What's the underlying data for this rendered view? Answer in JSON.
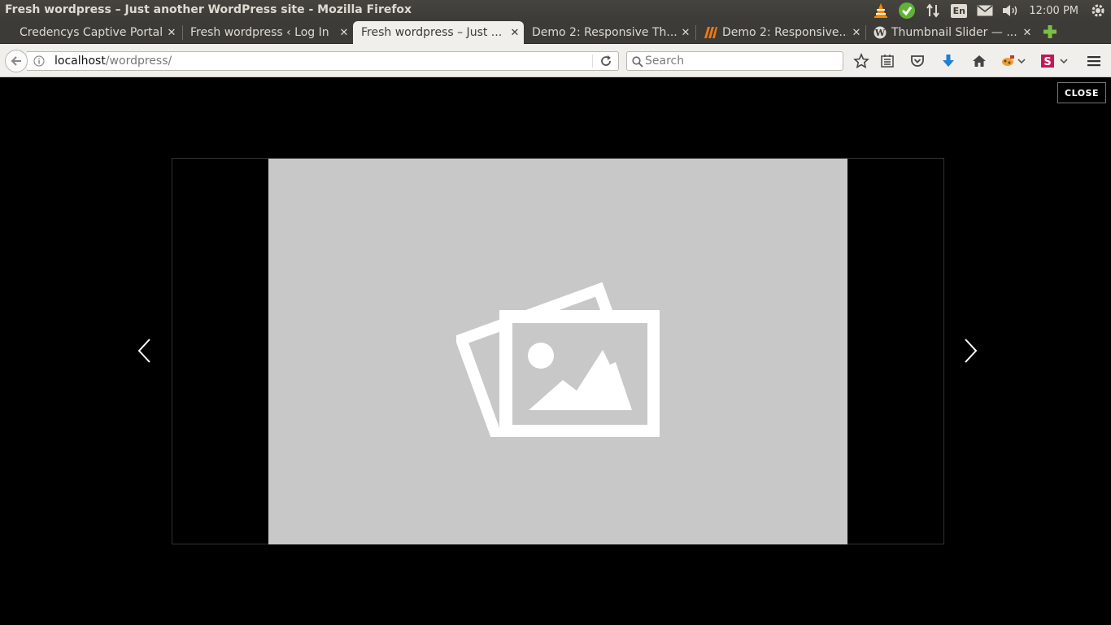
{
  "window": {
    "title": "Fresh wordpress – Just another WordPress site - Mozilla Firefox",
    "clock": "12:00 PM",
    "keyboard_layout": "En",
    "tray_icons": [
      "vlc-icon",
      "check-update-icon",
      "network-transfer-icon",
      "keyboard-layout-icon",
      "mail-icon",
      "volume-icon",
      "settings-gear-icon"
    ]
  },
  "tabs": [
    {
      "title": "Credencys Captive Portal",
      "favicon": "none",
      "active": false
    },
    {
      "title": "Fresh wordpress ‹ Log In",
      "favicon": "none",
      "active": false
    },
    {
      "title": "Fresh wordpress – Just ...",
      "favicon": "none",
      "active": true
    },
    {
      "title": "Demo 2: Responsive Th...",
      "favicon": "none",
      "active": false
    },
    {
      "title": "Demo 2: Responsive...",
      "favicon": "stripe-icon",
      "active": false
    },
    {
      "title": "Thumbnail Slider — ...",
      "favicon": "wordpress-icon",
      "active": false
    }
  ],
  "navbar": {
    "url_host": "localhost",
    "url_path": "/wordpress/",
    "search_placeholder": "Search",
    "toolbar_icons": [
      "bookmark-star-icon",
      "reading-list-icon",
      "pocket-icon",
      "downloads-icon",
      "home-icon",
      "addon-icon",
      "addon-s-icon",
      "menu-icon"
    ]
  },
  "lightbox": {
    "close_label": "CLOSE",
    "image_placeholder_icon": "image-placeholder-icon",
    "prev_icon": "chevron-left-icon",
    "next_icon": "chevron-right-icon"
  },
  "colors": {
    "titlebar": "#3c3b37",
    "toolbar": "#f0efec",
    "image_placeholder": "#c8c8c8",
    "download_arrow": "#1b7fd6",
    "new_tab_plus": "#7ac043"
  }
}
